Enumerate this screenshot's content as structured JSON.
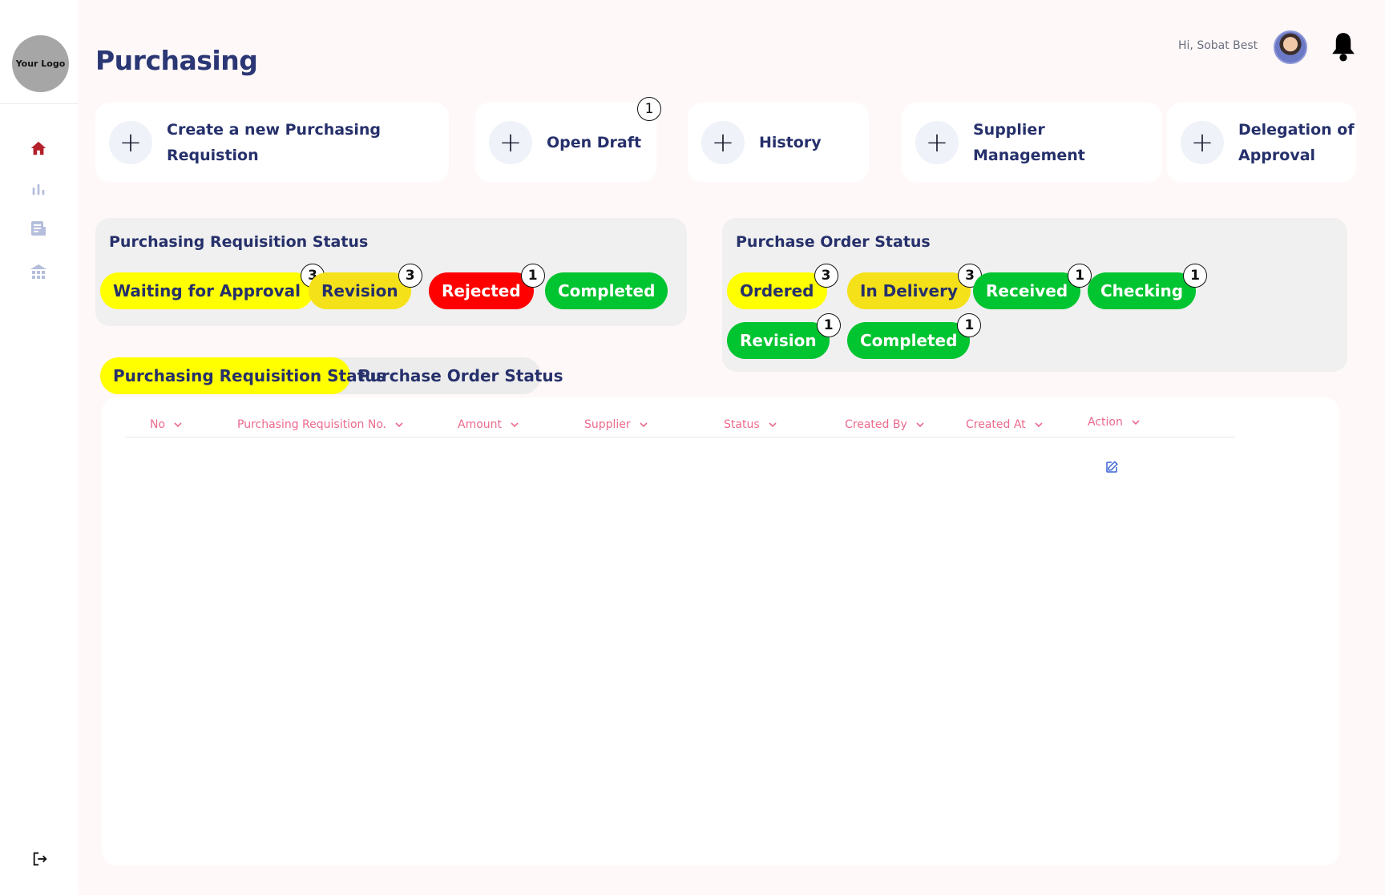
{
  "sidebar": {
    "logo_text": "Your Logo",
    "nav": [
      {
        "icon": "home-icon",
        "color": "#b3202a"
      },
      {
        "icon": "bar-chart-icon",
        "color": "#b5bedc"
      },
      {
        "icon": "document-icon",
        "color": "#b5bedc"
      },
      {
        "icon": "building-icon",
        "color": "#b5bedc"
      }
    ],
    "logout_icon": "logout-icon"
  },
  "header": {
    "title": "Purchasing",
    "greeting": "Hi, Sobat Best",
    "avatar_icon": "avatar",
    "bell_icon": "bell-icon"
  },
  "actions": [
    {
      "label": "Create a new Purchasing Requistion",
      "badge": ""
    },
    {
      "label": "Open Draft",
      "badge": "1"
    },
    {
      "label": "History",
      "badge": ""
    },
    {
      "label": "Supplier Management",
      "badge": ""
    },
    {
      "label": "Delegation of Approval",
      "badge": ""
    }
  ],
  "pr_status": {
    "title": "Purchasing Requisition Status",
    "items": [
      {
        "label": "Waiting for Approval",
        "count": "3",
        "bg": "#ffff00",
        "fg": "#26306b"
      },
      {
        "label": "Revision",
        "count": "3",
        "bg": "#f5e11a",
        "fg": "#26306b"
      },
      {
        "label": "Rejected",
        "count": "1",
        "bg": "#ff0000",
        "fg": "#ffffff"
      },
      {
        "label": "Completed",
        "count": "",
        "bg": "#00c430",
        "fg": "#ffffff"
      }
    ]
  },
  "po_status": {
    "title": "Purchase Order Status",
    "items": [
      {
        "label": "Ordered",
        "count": "3",
        "bg": "#ffff00",
        "fg": "#26306b"
      },
      {
        "label": "In Delivery",
        "count": "3",
        "bg": "#f5e11a",
        "fg": "#26306b"
      },
      {
        "label": "Received",
        "count": "1",
        "bg": "#00c430",
        "fg": "#ffffff"
      },
      {
        "label": "Checking",
        "count": "1",
        "bg": "#00c430",
        "fg": "#ffffff"
      },
      {
        "label": "Revision",
        "count": "1",
        "bg": "#00c430",
        "fg": "#ffffff"
      },
      {
        "label": "Completed",
        "count": "1",
        "bg": "#00c430",
        "fg": "#ffffff"
      }
    ]
  },
  "tabs": [
    {
      "label": "Purchasing Requisition Status",
      "active": true
    },
    {
      "label": "Purchase Order Status",
      "active": false
    }
  ],
  "table": {
    "columns": [
      "No",
      "Purchasing Requisition No.",
      "Amount",
      "Supplier",
      "Status",
      "Created By",
      "Created At",
      "Action"
    ],
    "rows": [
      {
        "action_icon": "edit-icon"
      }
    ]
  },
  "colors": {
    "accent_text": "#26306b",
    "header_pink": "#ec6a8e",
    "edit_blue": "#3a63d8"
  }
}
